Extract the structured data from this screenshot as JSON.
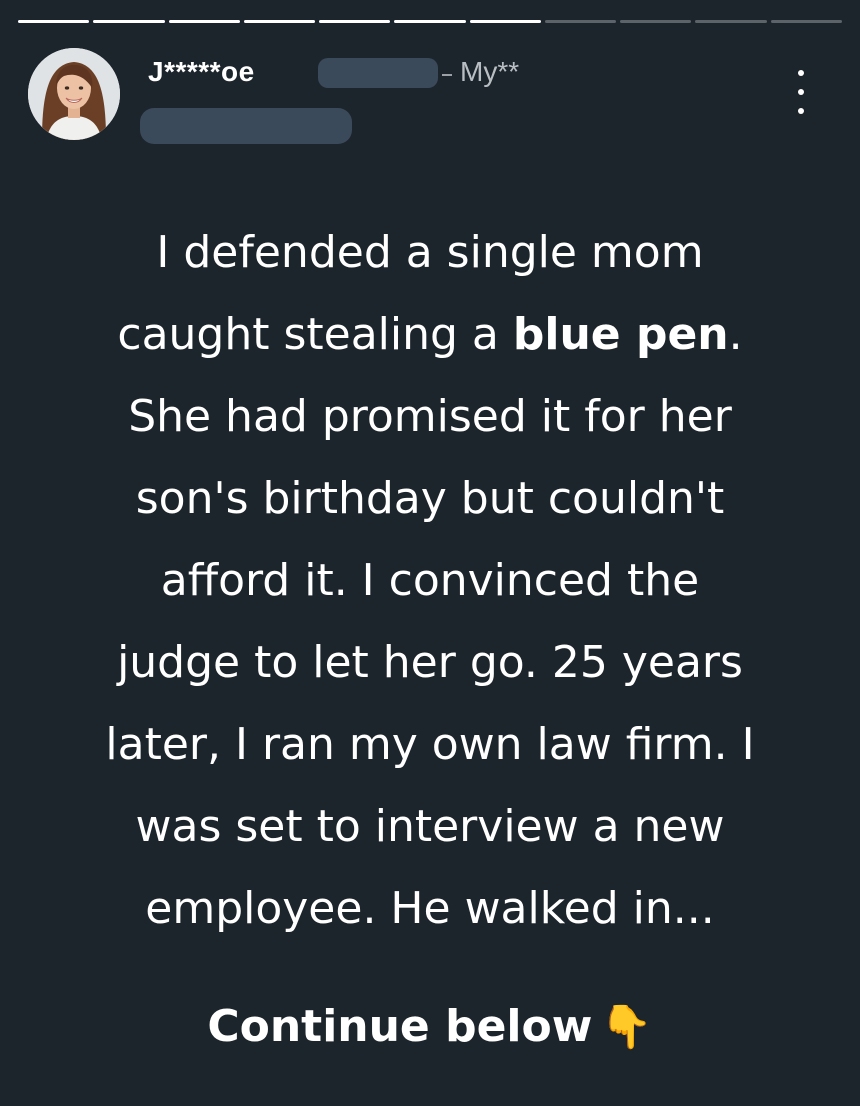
{
  "story_progress": {
    "segments_total": 11,
    "segments_completed": 7
  },
  "header": {
    "username": "J*****oe",
    "subname": "My**",
    "menu_icon": "more-vertical-icon",
    "avatar_icon": "profile-photo"
  },
  "story": {
    "line_1": "I defended a single mom",
    "line_2_before": "caught stealing a ",
    "line_2_bold": "blue pen",
    "line_2_after": ".",
    "line_3": "She had promised it for her",
    "line_4": "son's birthday but couldn't",
    "line_5": "afford it. I convinced the",
    "line_6": "judge to let her go. 25 years",
    "line_7": "later, I ran my own law firm. I",
    "line_8": "was set to interview a new",
    "line_9": "employee. He walked in..."
  },
  "cta": {
    "label": "Continue below",
    "emoji": "👇",
    "emoji_icon": "pointing-down-hand-icon"
  },
  "colors": {
    "background": "#1d252c",
    "text": "#ffffff",
    "redaction": "#3a4a5a",
    "progress_track": "#5c6369"
  }
}
